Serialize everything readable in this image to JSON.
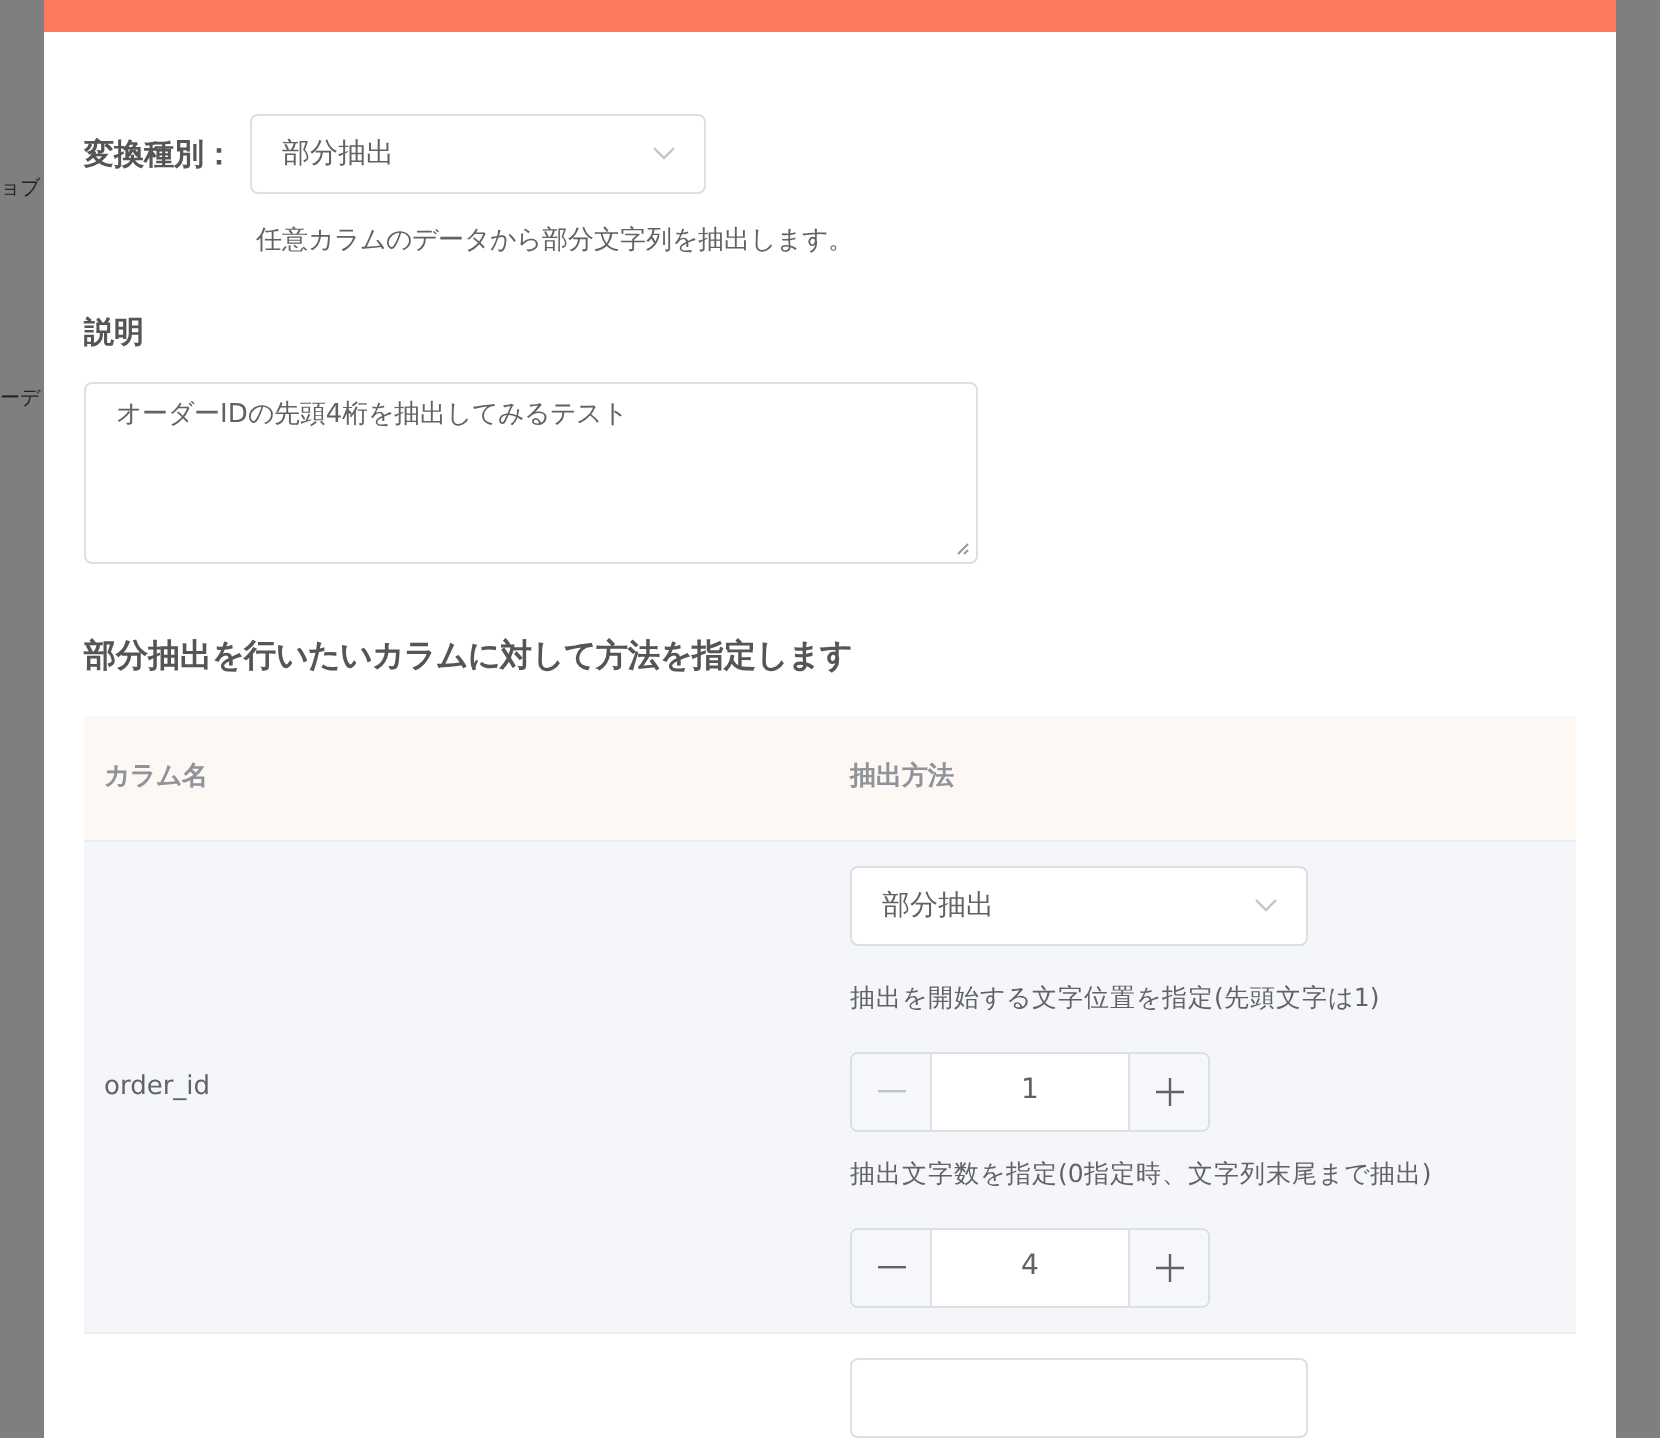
{
  "background": {
    "fragments": [
      "ョブ",
      "ーデ"
    ]
  },
  "modal": {
    "type_label": "変換種別：",
    "type_select": {
      "value": "部分抽出"
    },
    "type_description": "任意カラムのデータから部分文字列を抽出します。",
    "description_label": "説明",
    "description_value": "オーダーIDの先頭4桁を抽出してみるテスト",
    "section_heading": "部分抽出を行いたいカラムに対して方法を指定します",
    "table": {
      "columns": [
        "カラム名",
        "抽出方法"
      ],
      "rows": [
        {
          "column_name": "order_id",
          "method": "部分抽出",
          "start_label": "抽出を開始する文字位置を指定(先頭文字は1)",
          "start": {
            "value": "1",
            "minus_disabled": true
          },
          "length_label": "抽出文字数を指定(0指定時、文字列末尾まで抽出)",
          "length": {
            "value": "4",
            "minus_disabled": false
          }
        }
      ]
    }
  }
}
